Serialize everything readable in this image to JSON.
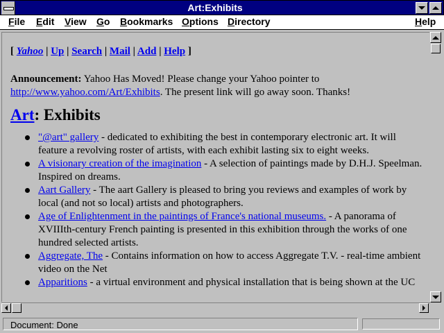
{
  "window": {
    "title": "Art:Exhibits"
  },
  "menu": {
    "file": "File",
    "edit": "Edit",
    "view": "View",
    "go": "Go",
    "bookmarks": "Bookmarks",
    "options": "Options",
    "directory": "Directory",
    "help": "Help"
  },
  "nav": {
    "open": "[",
    "close": "]",
    "sep": "|",
    "yahoo": "Yahoo",
    "up": "Up",
    "search": "Search",
    "mail": "Mail",
    "add": "Add",
    "help": "Help"
  },
  "announcement": {
    "label": "Announcement:",
    "text": "Yahoo Has Moved! Please change your Yahoo pointer to",
    "link": "http://www.yahoo.com/Art/Exhibits",
    "tail": ". The present link will go away soon. Thanks!"
  },
  "heading": {
    "link": "Art",
    "rest": ": Exhibits"
  },
  "items": [
    {
      "link": "\"@art\" gallery",
      "desc": " - dedicated to exhibiting the best in contemporary electronic art. It will feature a revolving roster of artists, with each exhibit lasting six to eight weeks."
    },
    {
      "link": "A visionary creation of the imagination",
      "desc": " - A selection of paintings made by D.H.J. Speelman. Inspired on dreams."
    },
    {
      "link": "Aart Gallery",
      "desc": " - The aart Gallery is pleased to bring you reviews and examples of work by local (and not so local) artists and photographers."
    },
    {
      "link": "Age of Enlightenment in the paintings of France's national museums.",
      "desc": " - A panorama of XVIIIth-century French painting is presented in this exhibition through the works of one hundred selected artists."
    },
    {
      "link": "Aggregate, The",
      "desc": " - Contains information on how to access Aggregate T.V. - real-time ambient video on the Net"
    },
    {
      "link": "Apparitions",
      "desc": " - a virtual environment and physical installation that is being shown at the UC"
    }
  ],
  "status": {
    "text": "Document: Done"
  }
}
